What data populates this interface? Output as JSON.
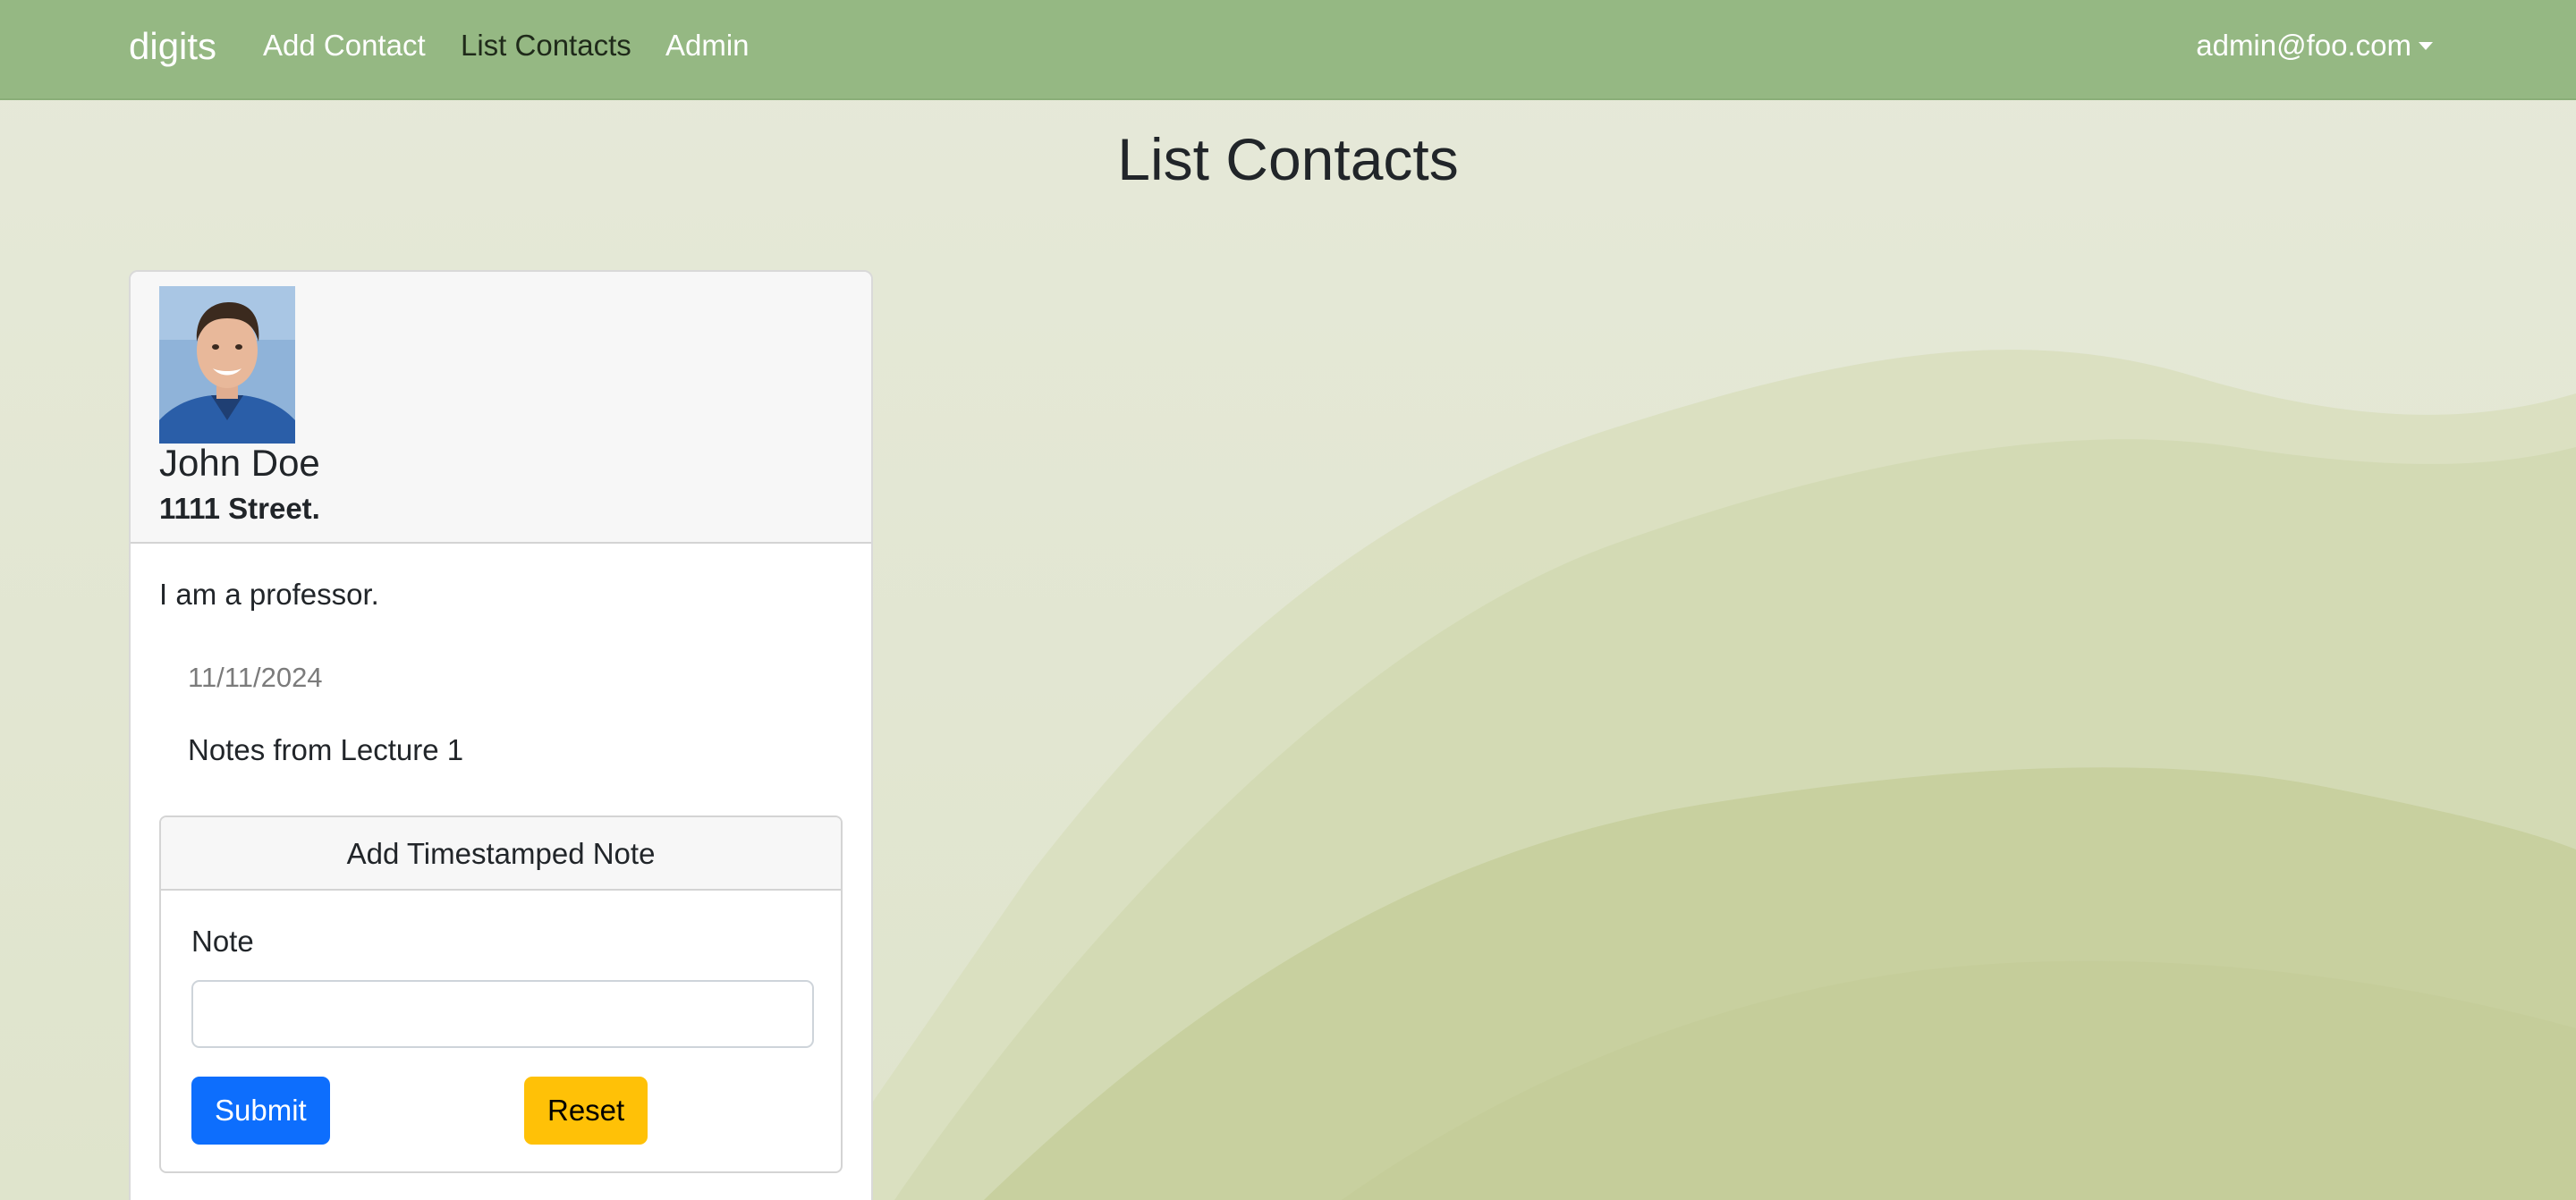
{
  "navbar": {
    "brand": "digits",
    "links": [
      {
        "label": "Add Contact",
        "active": false
      },
      {
        "label": "List Contacts",
        "active": true
      },
      {
        "label": "Admin",
        "active": false
      }
    ],
    "user": "admin@foo.com"
  },
  "page": {
    "title": "List Contacts"
  },
  "contact": {
    "name": "John Doe",
    "address": "1111 Street.",
    "description": "I am a professor.",
    "notes": [
      {
        "date": "11/11/2024",
        "text": "Notes from Lecture 1"
      }
    ]
  },
  "add_note_form": {
    "title": "Add Timestamped Note",
    "note_label": "Note",
    "note_value": "",
    "submit_label": "Submit",
    "reset_label": "Reset"
  },
  "colors": {
    "navbar": "#95b883",
    "submit": "#0d6efd",
    "reset": "#ffc107"
  }
}
